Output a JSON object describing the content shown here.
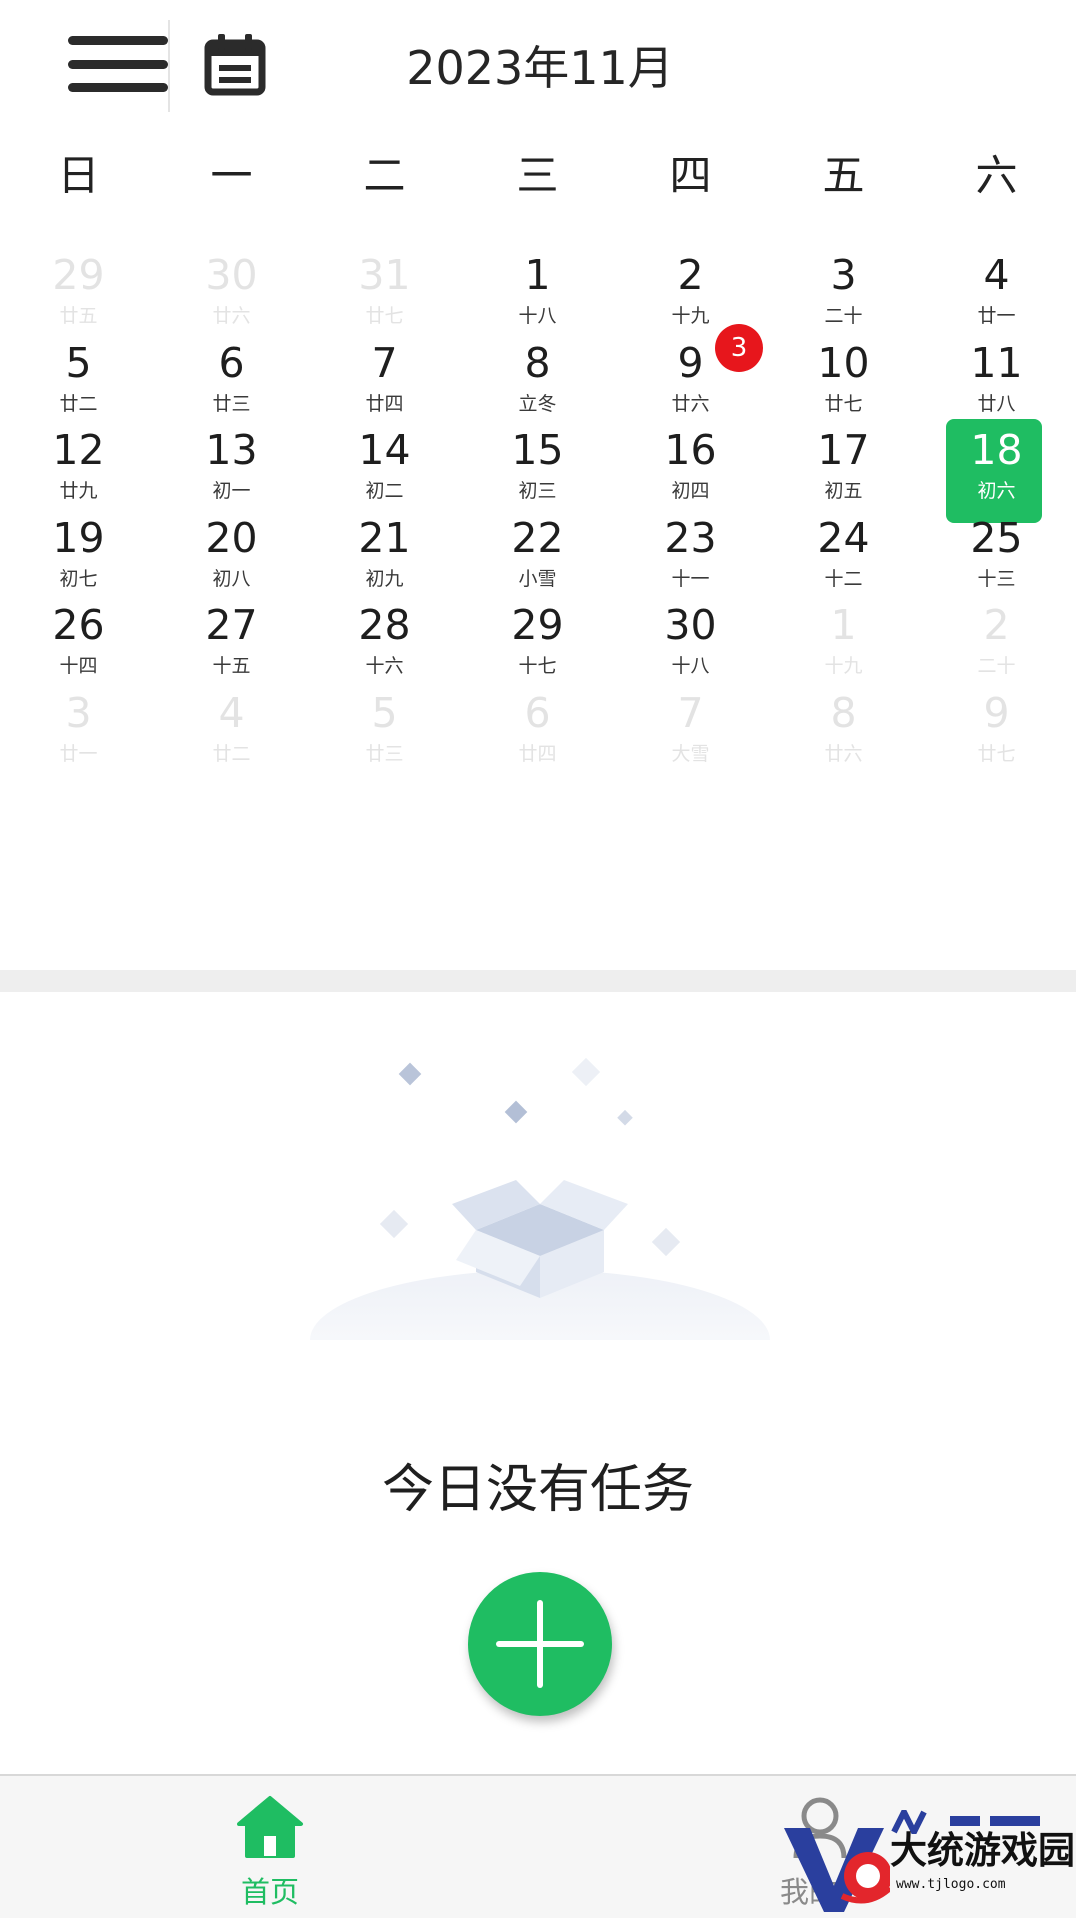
{
  "header": {
    "menu_icon": "hamburger-menu-icon",
    "calendar_icon": "calendar-icon",
    "title": "2023年11月"
  },
  "weekdays": [
    "日",
    "一",
    "二",
    "三",
    "四",
    "五",
    "六"
  ],
  "calendar": {
    "weeks": [
      [
        {
          "day": "29",
          "lunar": "廿五",
          "other_month": true
        },
        {
          "day": "30",
          "lunar": "廿六",
          "other_month": true
        },
        {
          "day": "31",
          "lunar": "廿七",
          "other_month": true
        },
        {
          "day": "1",
          "lunar": "十八"
        },
        {
          "day": "2",
          "lunar": "十九"
        },
        {
          "day": "3",
          "lunar": "二十"
        },
        {
          "day": "4",
          "lunar": "廿一"
        }
      ],
      [
        {
          "day": "5",
          "lunar": "廿二"
        },
        {
          "day": "6",
          "lunar": "廿三"
        },
        {
          "day": "7",
          "lunar": "廿四"
        },
        {
          "day": "8",
          "lunar": "立冬"
        },
        {
          "day": "9",
          "lunar": "廿六"
        },
        {
          "day": "10",
          "lunar": "廿七"
        },
        {
          "day": "11",
          "lunar": "廿八"
        }
      ],
      [
        {
          "day": "12",
          "lunar": "廿九"
        },
        {
          "day": "13",
          "lunar": "初一"
        },
        {
          "day": "14",
          "lunar": "初二"
        },
        {
          "day": "15",
          "lunar": "初三"
        },
        {
          "day": "16",
          "lunar": "初四"
        },
        {
          "day": "17",
          "lunar": "初五"
        },
        {
          "day": "18",
          "lunar": "初六",
          "selected": true
        }
      ],
      [
        {
          "day": "19",
          "lunar": "初七"
        },
        {
          "day": "20",
          "lunar": "初八"
        },
        {
          "day": "21",
          "lunar": "初九"
        },
        {
          "day": "22",
          "lunar": "小雪"
        },
        {
          "day": "23",
          "lunar": "十一"
        },
        {
          "day": "24",
          "lunar": "十二"
        },
        {
          "day": "25",
          "lunar": "十三"
        }
      ],
      [
        {
          "day": "26",
          "lunar": "十四"
        },
        {
          "day": "27",
          "lunar": "十五"
        },
        {
          "day": "28",
          "lunar": "十六"
        },
        {
          "day": "29",
          "lunar": "十七"
        },
        {
          "day": "30",
          "lunar": "十八"
        },
        {
          "day": "1",
          "lunar": "十九",
          "other_month": true
        },
        {
          "day": "2",
          "lunar": "二十",
          "other_month": true
        }
      ],
      [
        {
          "day": "3",
          "lunar": "廿一",
          "other_month": true
        },
        {
          "day": "4",
          "lunar": "廿二",
          "other_month": true
        },
        {
          "day": "5",
          "lunar": "廿三",
          "other_month": true
        },
        {
          "day": "6",
          "lunar": "廿四",
          "other_month": true
        },
        {
          "day": "7",
          "lunar": "大雪",
          "other_month": true
        },
        {
          "day": "8",
          "lunar": "廿六",
          "other_month": true
        },
        {
          "day": "9",
          "lunar": "廿七",
          "other_month": true
        }
      ]
    ],
    "badge": {
      "count": "3"
    },
    "selected_color": "#1fbd62",
    "badge_color": "#e7161c"
  },
  "empty_state": {
    "illustration": "empty-box-illustration",
    "message": "今日没有任务",
    "add_icon": "plus-icon"
  },
  "bottom_nav": {
    "items": [
      {
        "icon": "home-icon",
        "label": "首页",
        "active": true
      },
      {
        "icon": "user-icon",
        "label": "我的",
        "active": false
      }
    ],
    "active_color": "#1fbd62"
  },
  "watermark": {
    "text": "大统游戏园",
    "url": "www.tjlogo.com"
  }
}
